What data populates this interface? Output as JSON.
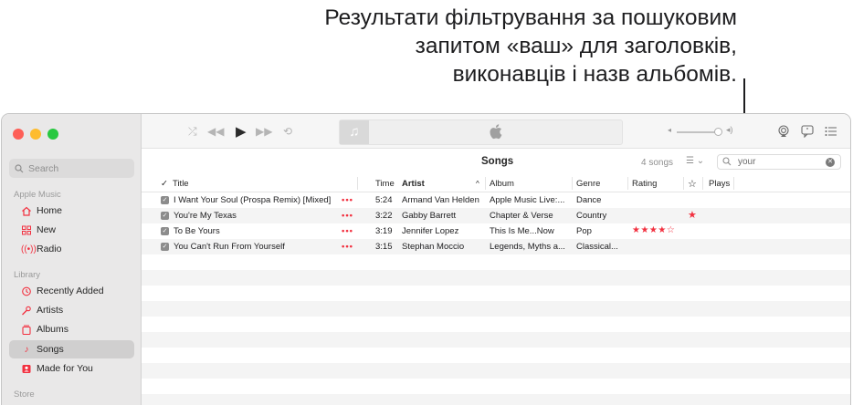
{
  "callout": {
    "line1": "Результати фільтрування за пошуковим",
    "line2": "запитом «ваш» для заголовків,",
    "line3": "виконавців і назв альбомів."
  },
  "sidebar": {
    "search_placeholder": "Search",
    "sections": [
      {
        "label": "Apple Music",
        "items": [
          {
            "label": "Home",
            "icon": "home-icon"
          },
          {
            "label": "New",
            "icon": "grid-icon"
          },
          {
            "label": "Radio",
            "icon": "radio-icon"
          }
        ]
      },
      {
        "label": "Library",
        "items": [
          {
            "label": "Recently Added",
            "icon": "clock-icon"
          },
          {
            "label": "Artists",
            "icon": "microphone-icon"
          },
          {
            "label": "Albums",
            "icon": "album-icon"
          },
          {
            "label": "Songs",
            "icon": "note-icon",
            "selected": true
          },
          {
            "label": "Made for You",
            "icon": "person-square-icon"
          }
        ]
      },
      {
        "label": "Store",
        "items": []
      }
    ]
  },
  "list": {
    "title": "Songs",
    "count": "4 songs",
    "filter_value": "your",
    "columns": {
      "check": "✓",
      "title": "Title",
      "time": "Time",
      "artist": "Artist",
      "album": "Album",
      "genre": "Genre",
      "rating": "Rating",
      "loved": "☆",
      "plays": "Plays"
    },
    "rows": [
      {
        "title": "I Want Your Soul (Prospa Remix) [Mixed]",
        "time": "5:24",
        "artist": "Armand Van Helden",
        "album": "Apple Music Live:...",
        "genre": "Dance",
        "rating": "",
        "loved": ""
      },
      {
        "title": "You're My Texas",
        "time": "3:22",
        "artist": "Gabby Barrett",
        "album": "Chapter & Verse",
        "genre": "Country",
        "rating": "",
        "loved": "★"
      },
      {
        "title": "To Be Yours",
        "time": "3:19",
        "artist": "Jennifer Lopez",
        "album": "This Is Me...Now",
        "genre": "Pop",
        "rating": "★★★★☆",
        "loved": ""
      },
      {
        "title": "You Can't Run From Yourself",
        "time": "3:15",
        "artist": "Stephan Moccio",
        "album": "Legends, Myths a...",
        "genre": "Classical...",
        "rating": "",
        "loved": ""
      }
    ],
    "more_glyph": "•••"
  },
  "colors": {
    "accent": "#f2303f",
    "sidebar_bg": "#e9e8e8",
    "stripe": "#f4f4f4"
  }
}
